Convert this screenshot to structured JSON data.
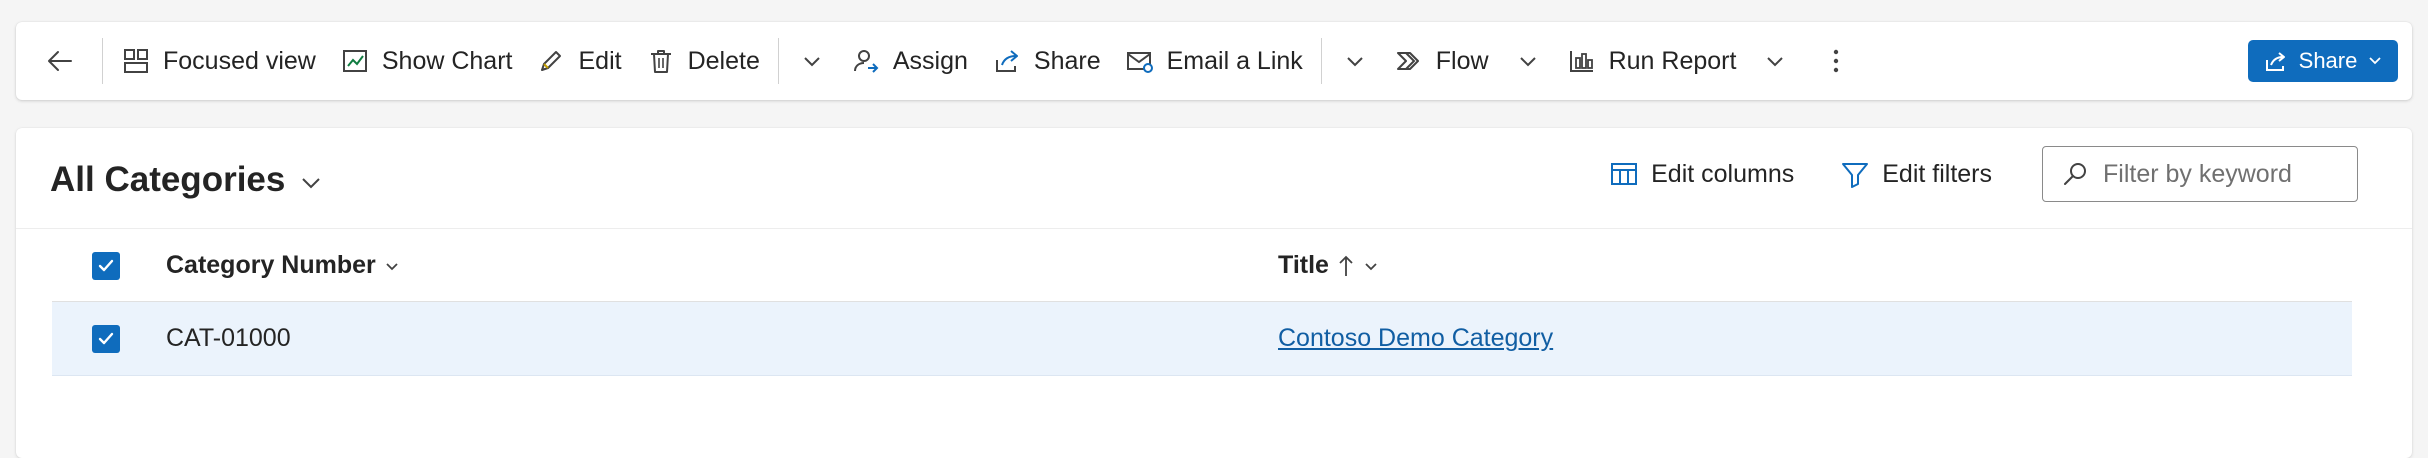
{
  "commandbar": {
    "back_label": "",
    "items": [
      {
        "label": "Focused view",
        "icon": "focused-view-icon"
      },
      {
        "label": "Show Chart",
        "icon": "chart-icon"
      },
      {
        "label": "Edit",
        "icon": "pencil-icon"
      },
      {
        "label": "Delete",
        "icon": "trash-icon"
      },
      {
        "label": "Assign",
        "icon": "assign-person-icon"
      },
      {
        "label": "Share",
        "icon": "share-icon"
      },
      {
        "label": "Email a Link",
        "icon": "mail-link-icon"
      },
      {
        "label": "Flow",
        "icon": "flow-icon"
      },
      {
        "label": "Run Report",
        "icon": "report-icon"
      }
    ],
    "primary_share_label": "Share"
  },
  "view": {
    "title": "All Categories",
    "edit_columns_label": "Edit columns",
    "edit_filters_label": "Edit filters",
    "search_placeholder": "Filter by keyword",
    "search_value": ""
  },
  "grid": {
    "columns": [
      {
        "label": "Category Number",
        "sort": "none"
      },
      {
        "label": "Title",
        "sort": "ascending"
      }
    ],
    "rows": [
      {
        "number": "CAT-01000",
        "title": "Contoso Demo Category",
        "selected": true
      }
    ],
    "all_selected": true
  },
  "colors": {
    "accent": "#0f6cbd",
    "link": "#115ea3",
    "selected_row": "#ebf3fc",
    "page_bg": "#f5f5f5"
  }
}
